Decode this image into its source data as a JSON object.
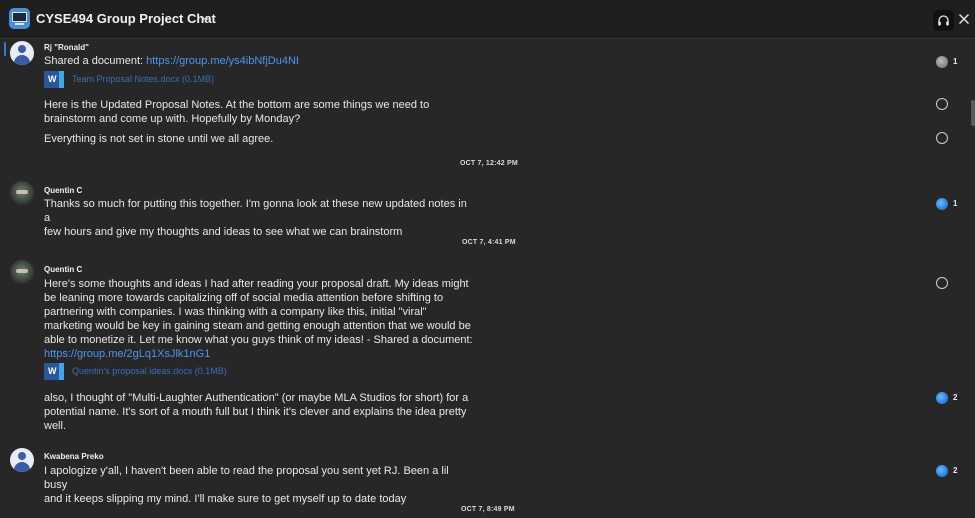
{
  "header": {
    "title": "CYSE494 Group Project Chat",
    "icons": {
      "group": "monitor-icon",
      "chevron": "chevron-down-icon",
      "call": "headset-icon",
      "close": "close-icon"
    }
  },
  "messages": [
    {
      "sender": "Rj \"Ronald\"",
      "text": "Shared a document: ",
      "link": "https://group.me/ys4ibNfjDu4NI",
      "attachment": "Team Proposal Notes.docx (0.1MB)",
      "likes": "1"
    },
    {
      "text": "Here is the Updated Proposal Notes. At the bottom are some things we need to\nbrainstorm and come up with. Hopefully by Monday?"
    },
    {
      "text": "Everything is not set in stone until we all agree."
    },
    {
      "sender": "Quentin C",
      "text": "Thanks so much for putting this together. I'm gonna look at these new updated notes in a\nfew hours and give my thoughts and ideas to see what we can brainstorm",
      "likes": "1"
    },
    {
      "sender": "Quentin C",
      "text": "Here's some thoughts and ideas I had after reading your proposal draft. My ideas might\nbe leaning more towards capitalizing off of social media attention before shifting to\npartnering with companies. I was thinking with a company like this, initial \"viral\"\nmarketing would be key in gaining steam and getting enough attention that we would be\nable to monetize it. Let me know what you guys think of my ideas! - Shared a document:",
      "link": "https://group.me/2gLq1XsJlk1nG1",
      "attachment": "Quentin's proposal ideas.docx (0.1MB)"
    },
    {
      "text": "also, I thought of \"Multi-Laughter Authentication\" (or maybe MLA Studios for short) for a\npotential name. It's sort of a mouth full but I think it's clever and explains the idea pretty\nwell.",
      "likes": "2"
    },
    {
      "sender": "Kwabena Preko",
      "text": "I apologize y'all, I haven't been able to read the proposal you sent yet RJ. Been a lil busy\nand it keeps slipping my mind. I'll make sure to get myself up to date today",
      "likes": "2"
    }
  ],
  "timestamps": [
    "OCT 7, 12:42 PM",
    "OCT 7, 4:41 PM",
    "OCT 7, 8:49 PM"
  ],
  "colors": {
    "background": "#272727",
    "link": "#4d95ef",
    "like_active": "#2f88e6",
    "word": "#2b579a"
  }
}
